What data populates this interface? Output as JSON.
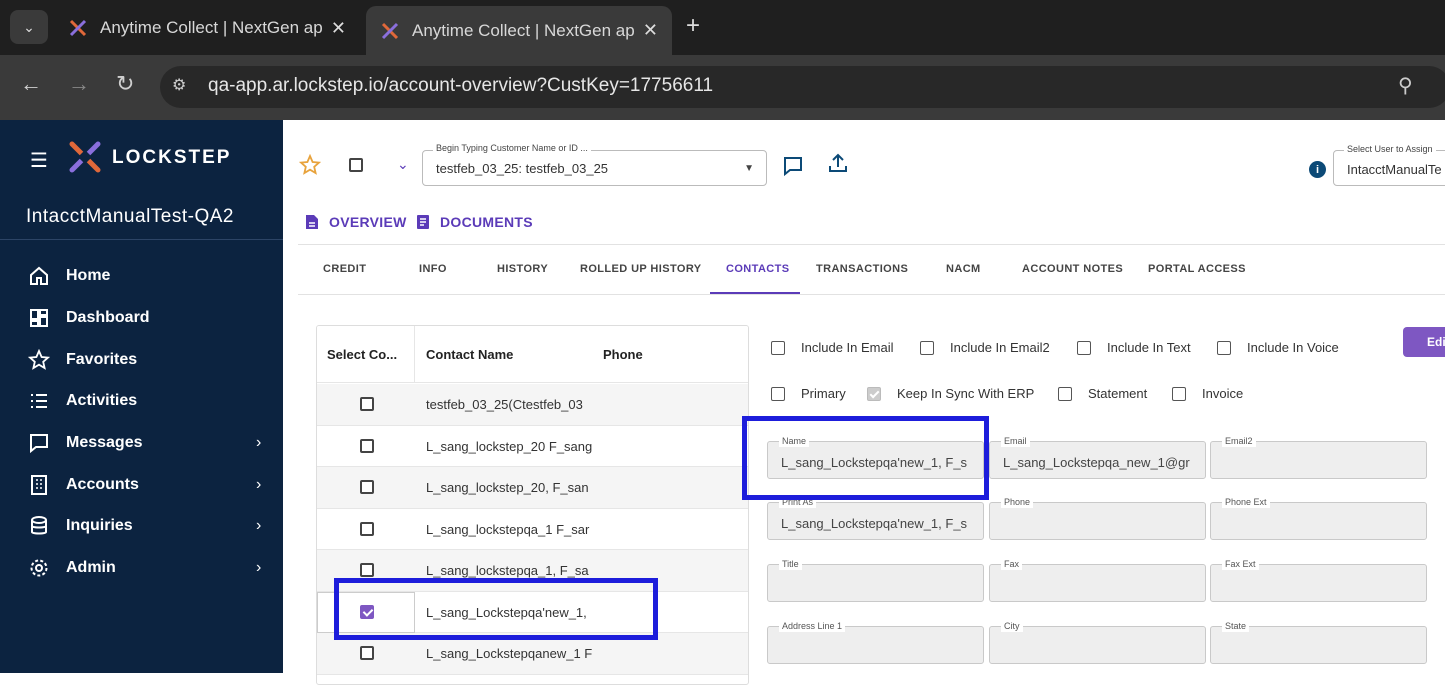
{
  "browser": {
    "tabs": [
      {
        "title": "Anytime Collect | NextGen app"
      },
      {
        "title": "Anytime Collect | NextGen app"
      }
    ],
    "url": "qa-app.ar.lockstep.io/account-overview?CustKey=17756611",
    "icons": {
      "back": "back-arrow-icon",
      "forward": "forward-arrow-icon",
      "reload": "reload-icon",
      "site_info": "tune-icon",
      "zoom": "zoom-icon",
      "close": "close-icon",
      "new_tab": "plus-icon"
    }
  },
  "sidebar": {
    "brand": "LOCKSTEP",
    "account": "IntacctManualTest-QA2",
    "items": [
      {
        "label": "Home",
        "icon": "home-icon",
        "has_children": false
      },
      {
        "label": "Dashboard",
        "icon": "dashboard-icon",
        "has_children": false
      },
      {
        "label": "Favorites",
        "icon": "star-icon",
        "has_children": false
      },
      {
        "label": "Activities",
        "icon": "list-icon",
        "has_children": false
      },
      {
        "label": "Messages",
        "icon": "message-icon",
        "has_children": true
      },
      {
        "label": "Accounts",
        "icon": "building-icon",
        "has_children": true
      },
      {
        "label": "Inquiries",
        "icon": "database-icon",
        "has_children": true
      },
      {
        "label": "Admin",
        "icon": "gear-icon",
        "has_children": true
      }
    ],
    "colors": {
      "bg": "#0c2340"
    }
  },
  "header": {
    "customer_label": "Begin Typing Customer Name or ID ...",
    "customer_value": "testfeb_03_25: testfeb_03_25",
    "user_label": "Select User to Assign",
    "user_value": "IntacctManualTe",
    "info_glyph": "i"
  },
  "top_tabs": [
    {
      "label": "OVERVIEW",
      "icon": "file-icon"
    },
    {
      "label": "DOCUMENTS",
      "icon": "document-icon"
    }
  ],
  "sub_tabs": [
    "CREDIT",
    "INFO",
    "HISTORY",
    "ROLLED UP HISTORY",
    "CONTACTS",
    "TRANSACTIONS",
    "NACM",
    "ACCOUNT NOTES",
    "PORTAL ACCESS"
  ],
  "active_sub_tab": "CONTACTS",
  "contacts_table": {
    "headers": [
      "Select Co...",
      "Contact Name",
      "Phone"
    ],
    "rows": [
      {
        "name": "testfeb_03_25(Ctestfeb_03",
        "checked": false
      },
      {
        "name": "L_sang_lockstep_20 F_sang",
        "checked": false
      },
      {
        "name": "L_sang_lockstep_20, F_san",
        "checked": false
      },
      {
        "name": "L_sang_lockstepqa_1 F_sar",
        "checked": false
      },
      {
        "name": "L_sang_lockstepqa_1, F_sa",
        "checked": false
      },
      {
        "name": "L_sang_Lockstepqa'new_1,",
        "checked": true
      },
      {
        "name": "L_sang_Lockstepqanew_1 F",
        "checked": false
      }
    ]
  },
  "flags": {
    "include_email": "Include In Email",
    "include_email2": "Include In Email2",
    "include_text": "Include In Text",
    "include_voice": "Include In Voice",
    "primary": "Primary",
    "keep_sync": "Keep In Sync With ERP",
    "statement": "Statement",
    "invoice": "Invoice"
  },
  "edit_label": "Edit",
  "fields": {
    "name": {
      "label": "Name",
      "value": "L_sang_Lockstepqa'new_1, F_s"
    },
    "email": {
      "label": "Email",
      "value": "L_sang_Lockstepqa_new_1@gr"
    },
    "email2": {
      "label": "Email2",
      "value": ""
    },
    "print_as": {
      "label": "Print As",
      "value": "L_sang_Lockstepqa'new_1, F_s"
    },
    "phone": {
      "label": "Phone",
      "value": ""
    },
    "phone_ext": {
      "label": "Phone Ext",
      "value": ""
    },
    "title": {
      "label": "Title",
      "value": ""
    },
    "fax": {
      "label": "Fax",
      "value": ""
    },
    "fax_ext": {
      "label": "Fax Ext",
      "value": ""
    },
    "address1": {
      "label": "Address Line 1",
      "value": ""
    },
    "city": {
      "label": "City",
      "value": ""
    },
    "state": {
      "label": "State",
      "value": ""
    }
  },
  "colors": {
    "accent": "#5b3bb8",
    "highlight": "#1d1ddb"
  }
}
